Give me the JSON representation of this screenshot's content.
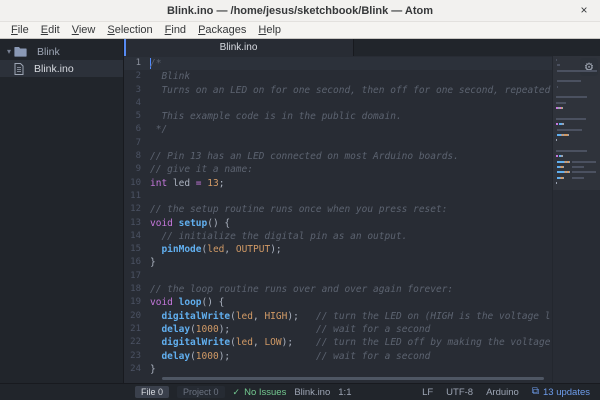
{
  "window": {
    "title": "Blink.ino — /home/jesus/sketchbook/Blink — Atom"
  },
  "icons": {
    "close": "×",
    "chevron_down": "▾",
    "check": "✓",
    "gear": "⚙",
    "package": "⧉"
  },
  "menubar": {
    "items": [
      {
        "label": "File",
        "mnemonic": "F"
      },
      {
        "label": "Edit",
        "mnemonic": "E"
      },
      {
        "label": "View",
        "mnemonic": "V"
      },
      {
        "label": "Selection",
        "mnemonic": "S"
      },
      {
        "label": "Find",
        "mnemonic": "F"
      },
      {
        "label": "Packages",
        "mnemonic": "P"
      },
      {
        "label": "Help",
        "mnemonic": "H"
      }
    ]
  },
  "tree": {
    "rows": [
      {
        "type": "folder",
        "label": "Blink",
        "expanded": true,
        "selected": false
      },
      {
        "type": "file",
        "label": "Blink.ino",
        "selected": true
      }
    ]
  },
  "tabs": {
    "active": "Blink.ino"
  },
  "editor": {
    "active_line": 1,
    "cursor_position": "1:1",
    "lines": [
      {
        "n": 1,
        "tokens": [
          [
            "/*",
            "c"
          ]
        ]
      },
      {
        "n": 2,
        "tokens": [
          [
            "  Blink",
            "c"
          ]
        ]
      },
      {
        "n": 3,
        "tokens": [
          [
            "  Turns on an LED on for one second, then off for one second, repeated",
            "c"
          ]
        ]
      },
      {
        "n": 4,
        "tokens": []
      },
      {
        "n": 5,
        "tokens": [
          [
            "  This example code is in the public domain.",
            "c"
          ]
        ]
      },
      {
        "n": 6,
        "tokens": [
          [
            " */",
            "c"
          ]
        ]
      },
      {
        "n": 7,
        "tokens": []
      },
      {
        "n": 8,
        "tokens": [
          [
            "// Pin 13 has an LED connected on most Arduino boards.",
            "c"
          ]
        ]
      },
      {
        "n": 9,
        "tokens": [
          [
            "// give it a name:",
            "c"
          ]
        ]
      },
      {
        "n": 10,
        "tokens": [
          [
            "int",
            "k"
          ],
          [
            " led ",
            "p"
          ],
          [
            "=",
            "o"
          ],
          [
            " ",
            "p"
          ],
          [
            "13",
            "n"
          ],
          [
            ";",
            "p"
          ]
        ]
      },
      {
        "n": 11,
        "tokens": []
      },
      {
        "n": 12,
        "tokens": [
          [
            "// the setup routine runs once when you press reset:",
            "c"
          ]
        ]
      },
      {
        "n": 13,
        "tokens": [
          [
            "void",
            "k"
          ],
          [
            " ",
            "p"
          ],
          [
            "setup",
            "f"
          ],
          [
            "() {",
            "p"
          ]
        ]
      },
      {
        "n": 14,
        "tokens": [
          [
            "  // initialize the digital pin as an output.",
            "c"
          ]
        ]
      },
      {
        "n": 15,
        "tokens": [
          [
            "  ",
            "p"
          ],
          [
            "pinMode",
            "f"
          ],
          [
            "(",
            "p"
          ],
          [
            "led",
            "n"
          ],
          [
            ", ",
            "p"
          ],
          [
            "OUTPUT",
            "n"
          ],
          [
            ");",
            "p"
          ]
        ]
      },
      {
        "n": 16,
        "tokens": [
          [
            "}",
            "p"
          ]
        ]
      },
      {
        "n": 17,
        "tokens": []
      },
      {
        "n": 18,
        "tokens": [
          [
            "// the loop routine runs over and over again forever:",
            "c"
          ]
        ]
      },
      {
        "n": 19,
        "tokens": [
          [
            "void",
            "k"
          ],
          [
            " ",
            "p"
          ],
          [
            "loop",
            "f"
          ],
          [
            "() {",
            "p"
          ]
        ]
      },
      {
        "n": 20,
        "tokens": [
          [
            "  ",
            "p"
          ],
          [
            "digitalWrite",
            "f"
          ],
          [
            "(",
            "p"
          ],
          [
            "led",
            "n"
          ],
          [
            ", ",
            "p"
          ],
          [
            "HIGH",
            "n"
          ],
          [
            ");",
            "p"
          ],
          [
            "   ",
            "p"
          ],
          [
            "// turn the LED on (HIGH is the voltage l",
            "c"
          ]
        ]
      },
      {
        "n": 21,
        "tokens": [
          [
            "  ",
            "p"
          ],
          [
            "delay",
            "f"
          ],
          [
            "(",
            "p"
          ],
          [
            "1000",
            "n"
          ],
          [
            ");",
            "p"
          ],
          [
            "               ",
            "p"
          ],
          [
            "// wait for a second",
            "c"
          ]
        ]
      },
      {
        "n": 22,
        "tokens": [
          [
            "  ",
            "p"
          ],
          [
            "digitalWrite",
            "f"
          ],
          [
            "(",
            "p"
          ],
          [
            "led",
            "n"
          ],
          [
            ", ",
            "p"
          ],
          [
            "LOW",
            "n"
          ],
          [
            ");",
            "p"
          ],
          [
            "    ",
            "p"
          ],
          [
            "// turn the LED off by making the voltage",
            "c"
          ]
        ]
      },
      {
        "n": 23,
        "tokens": [
          [
            "  ",
            "p"
          ],
          [
            "delay",
            "f"
          ],
          [
            "(",
            "p"
          ],
          [
            "1000",
            "n"
          ],
          [
            ");",
            "p"
          ],
          [
            "               ",
            "p"
          ],
          [
            "// wait for a second",
            "c"
          ]
        ]
      },
      {
        "n": 24,
        "tokens": [
          [
            "}",
            "p"
          ]
        ]
      }
    ]
  },
  "statusbar": {
    "left": {
      "file_count": "File 0",
      "project_count": "Project 0",
      "lint_status": "No Issues",
      "file_name": "Blink.ino",
      "cursor": "1:1"
    },
    "right": {
      "line_ending": "LF",
      "encoding": "UTF-8",
      "grammar": "Arduino",
      "updates": "13 updates"
    }
  },
  "colors": {
    "accent": "#568af2",
    "cursor": "#528bff",
    "editor_bg": "#282c34",
    "panel_bg": "#21252b",
    "comment": "#5c6370",
    "keyword": "#c678dd",
    "function": "#61afef",
    "constant": "#d19a66",
    "plain": "#abb2bf",
    "lint_ok_green": "#73c990",
    "updates_blue": "#6d9ceb",
    "mini": {
      "c": "#4b5160",
      "k": "#c678dd",
      "f": "#61afef",
      "n": "#d19a66",
      "p": "#9aa1b0",
      "o": "#c678dd"
    }
  }
}
